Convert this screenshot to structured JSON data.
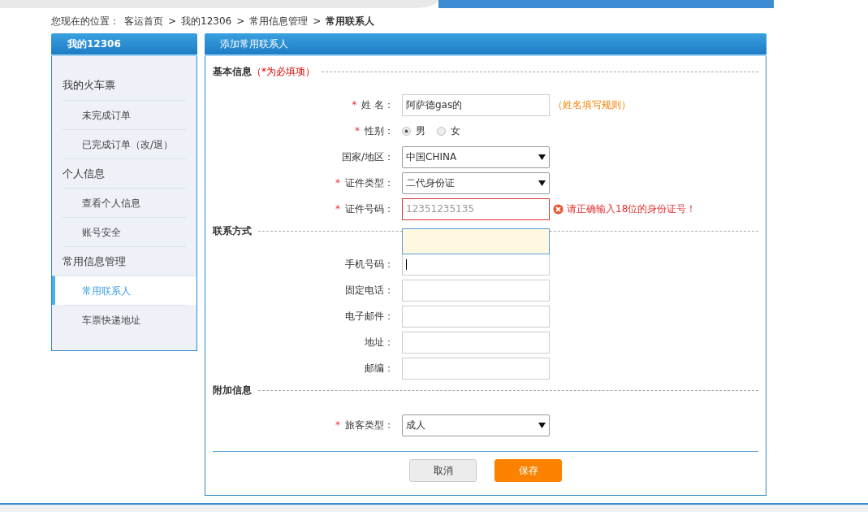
{
  "breadcrumb": {
    "prefix": "您现在的位置：",
    "items": [
      {
        "label": "客运首页",
        "current": false
      },
      {
        "separator": ">",
        "label": "我的12306",
        "current": false
      },
      {
        "separator": ">",
        "label": "常用信息管理",
        "current": false
      },
      {
        "separator": ">",
        "label": "常用联系人",
        "current": true
      }
    ]
  },
  "sidebar": {
    "title": "我的12306",
    "groups": [
      {
        "label": "我的火车票",
        "children": [
          {
            "label": "未完成订单",
            "selected": false
          },
          {
            "label": "已完成订单（改/退）",
            "selected": false
          }
        ]
      },
      {
        "label": "个人信息",
        "children": [
          {
            "label": "查看个人信息",
            "selected": false
          },
          {
            "label": "账号安全",
            "selected": false
          }
        ]
      },
      {
        "label": "常用信息管理",
        "children": [
          {
            "label": "常用联系人",
            "selected": true
          },
          {
            "label": "车票快递地址",
            "selected": false
          }
        ]
      }
    ]
  },
  "form": {
    "title": "添加常用联系人",
    "required_mark": "*",
    "sections": [
      {
        "title": "基本信息",
        "note": "（*为必填项）",
        "fields": [
          {
            "kind": "text",
            "label": "姓 名：",
            "required": true,
            "value": "阿萨德gas的",
            "hint": "（姓名填写规则）",
            "invalid": false,
            "focused": false
          },
          {
            "kind": "radio",
            "label": "性别：",
            "required": true,
            "options": [
              {
                "label": "男",
                "selected": true
              },
              {
                "label": "女",
                "selected": false
              }
            ]
          },
          {
            "kind": "select",
            "label": "国家/地区：",
            "required": false,
            "value": "中国CHINA"
          },
          {
            "kind": "select",
            "label": "证件类型：",
            "required": true,
            "value": "二代身份证"
          },
          {
            "kind": "text",
            "label": "证件号码：",
            "required": true,
            "placeholder": "12351235135",
            "invalid": true,
            "error": "请正确输入18位的身份证号！",
            "focused": false,
            "suggestion_popup": true
          }
        ]
      },
      {
        "title": "联系方式",
        "fields": [
          {
            "kind": "text",
            "label": "手机号码：",
            "required": false,
            "invalid": false,
            "focused": true
          },
          {
            "kind": "text",
            "label": "固定电话：",
            "required": false,
            "invalid": false,
            "focused": false
          },
          {
            "kind": "text",
            "label": "电子邮件：",
            "required": false,
            "invalid": false,
            "focused": false
          },
          {
            "kind": "text",
            "label": "地址：",
            "required": false,
            "invalid": false,
            "focused": false
          },
          {
            "kind": "text",
            "label": "邮编：",
            "required": false,
            "invalid": false,
            "focused": false
          }
        ]
      },
      {
        "title": "附加信息",
        "fields": [
          {
            "kind": "select",
            "label": "旅客类型：",
            "required": true,
            "value": "成人"
          }
        ]
      }
    ],
    "buttons": [
      {
        "label": "取消",
        "kind": "secondary"
      },
      {
        "label": "保存",
        "kind": "primary"
      }
    ]
  }
}
